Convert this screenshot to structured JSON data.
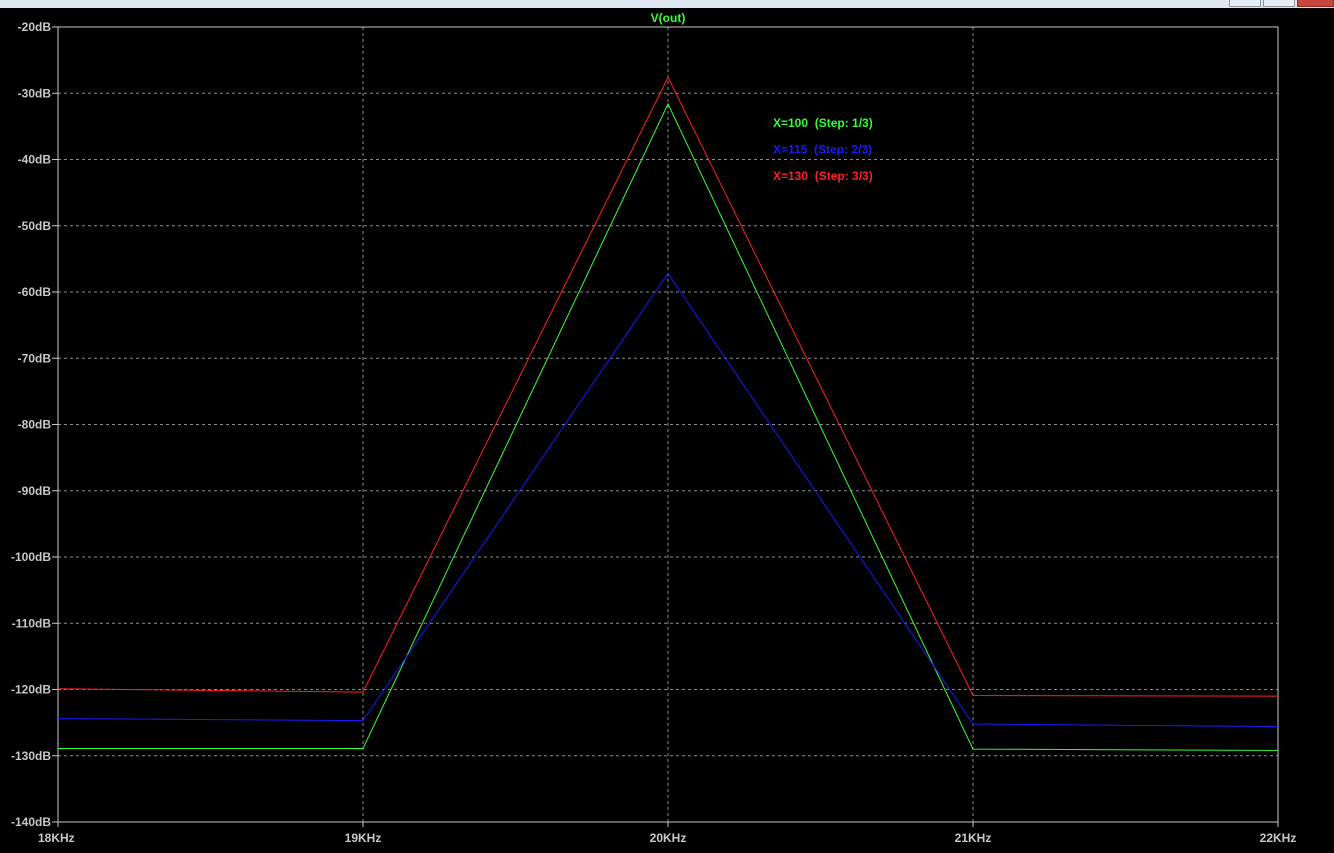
{
  "window": {
    "buttons": [
      "minimize",
      "maximize",
      "close"
    ]
  },
  "chart_data": {
    "type": "line",
    "title": "V(out)",
    "title_color": "#33ff33",
    "xlabel": "",
    "ylabel": "",
    "x_scale": "linear",
    "xlim": [
      18,
      22
    ],
    "ylim": [
      -140,
      -20
    ],
    "x_ticks": [
      {
        "value": 18,
        "label": "18KHz"
      },
      {
        "value": 19,
        "label": "19KHz"
      },
      {
        "value": 20,
        "label": "20KHz"
      },
      {
        "value": 21,
        "label": "21KHz"
      },
      {
        "value": 22,
        "label": "22KHz"
      }
    ],
    "y_ticks": [
      {
        "value": -20,
        "label": "-20dB"
      },
      {
        "value": -30,
        "label": "-30dB"
      },
      {
        "value": -40,
        "label": "-40dB"
      },
      {
        "value": -50,
        "label": "-50dB"
      },
      {
        "value": -60,
        "label": "-60dB"
      },
      {
        "value": -70,
        "label": "-70dB"
      },
      {
        "value": -80,
        "label": "-80dB"
      },
      {
        "value": -90,
        "label": "-90dB"
      },
      {
        "value": -100,
        "label": "-100dB"
      },
      {
        "value": -110,
        "label": "-110dB"
      },
      {
        "value": -120,
        "label": "-120dB"
      },
      {
        "value": -130,
        "label": "-130dB"
      },
      {
        "value": -140,
        "label": "-140dB"
      }
    ],
    "grid": true,
    "legend_position": "top-right",
    "series": [
      {
        "name": "X=100  (Step: 1/3)",
        "color": "#33ff33",
        "x": [
          18,
          19,
          20,
          21,
          22
        ],
        "y": [
          -128.9,
          -128.9,
          -31.6,
          -129.0,
          -129.2
        ]
      },
      {
        "name": "X=115  (Step: 2/3)",
        "color": "#1a1aff",
        "x": [
          18,
          19,
          20,
          21,
          22
        ],
        "y": [
          -124.4,
          -124.7,
          -57.2,
          -125.2,
          -125.6
        ]
      },
      {
        "name": "X=130  (Step: 3/3)",
        "color": "#ff2020",
        "x": [
          18,
          19,
          20,
          21,
          22
        ],
        "y": [
          -119.9,
          -120.4,
          -27.6,
          -120.9,
          -121.0
        ]
      }
    ]
  }
}
